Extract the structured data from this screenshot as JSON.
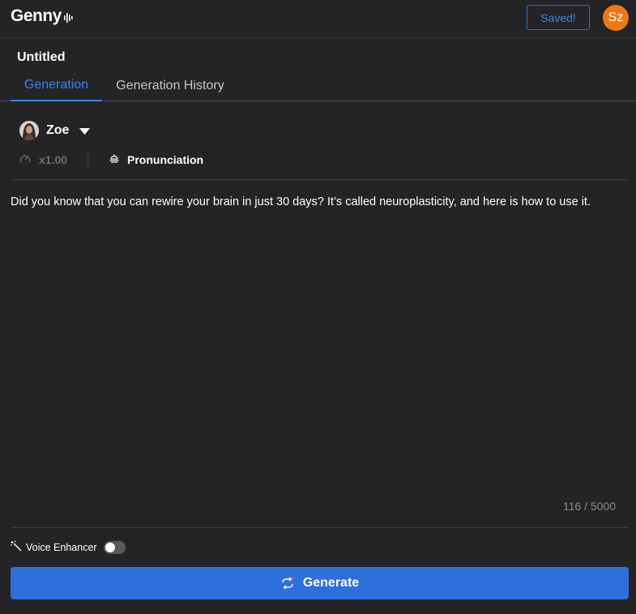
{
  "app": {
    "logo": "Genny",
    "saved_label": "Saved!",
    "user_initials": "Sz"
  },
  "document": {
    "title": "Untitled"
  },
  "tabs": [
    {
      "label": "Generation",
      "active": true
    },
    {
      "label": "Generation History",
      "active": false
    }
  ],
  "voice": {
    "name": "Zoe",
    "speed": "x1.00",
    "pronunciation_label": "Pronunciation"
  },
  "script": {
    "text": "Did you know that you can rewire your brain in just 30 days? It’s called neuroplasticity, and here is how to use it.",
    "counter": "116 / 5000"
  },
  "enhancer": {
    "label": "Voice Enhancer",
    "enabled": false
  },
  "generate": {
    "label": "Generate"
  },
  "colors": {
    "background": "#242426",
    "accent": "#3d82f0",
    "button": "#2f6fdc",
    "avatar": "#f07716"
  }
}
